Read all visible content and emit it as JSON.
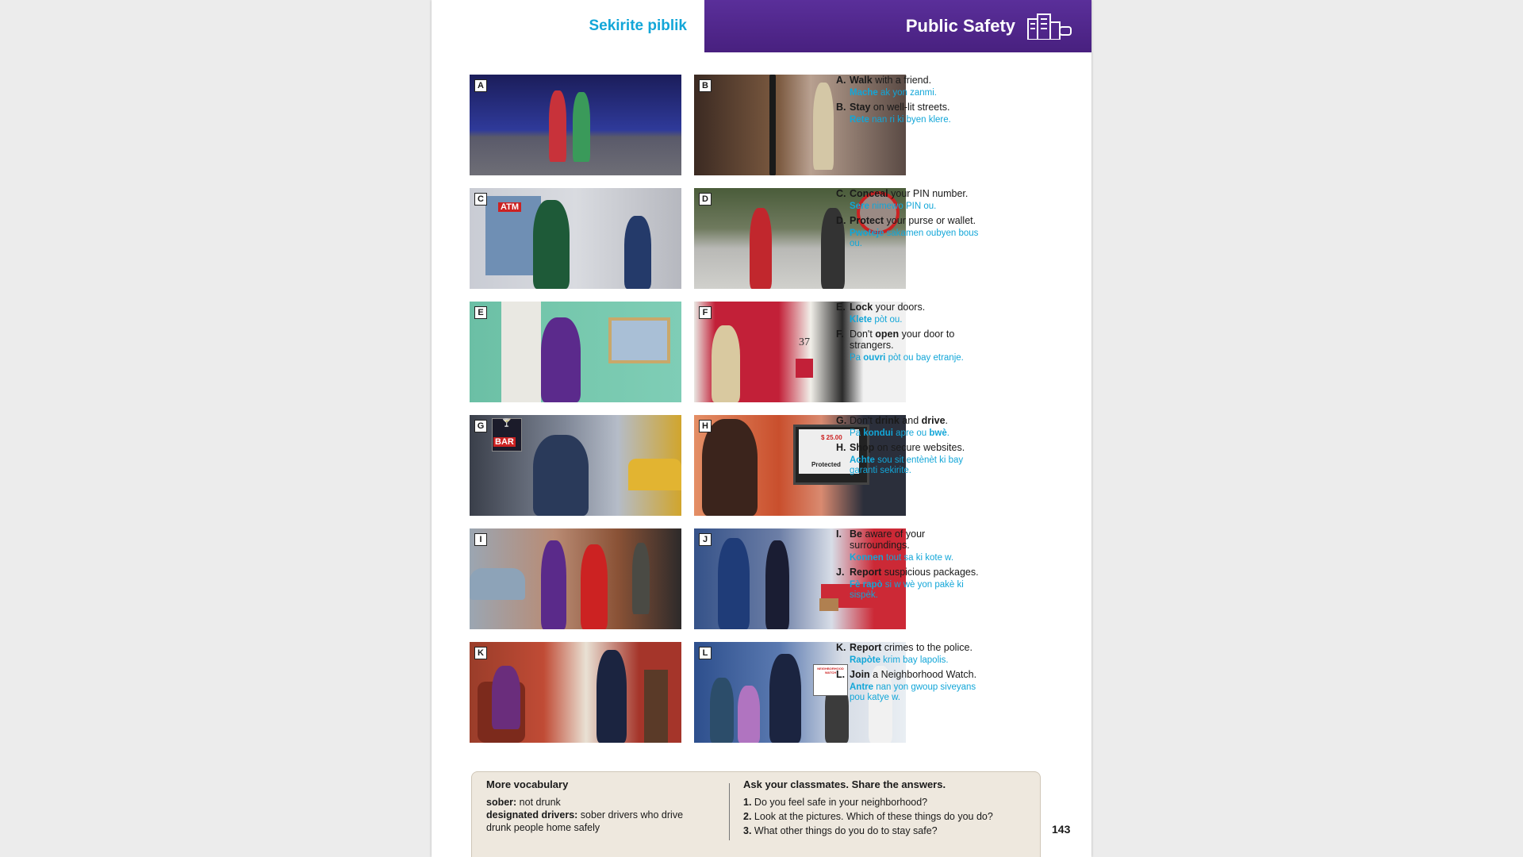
{
  "header": {
    "left_title": "Sekirite piblik",
    "right_title": "Public Safety",
    "header_color": "#4e2588",
    "accent_color": "#12a6d8"
  },
  "pictures": [
    {
      "letter": "A"
    },
    {
      "letter": "B"
    },
    {
      "letter": "C"
    },
    {
      "letter": "D"
    },
    {
      "letter": "E"
    },
    {
      "letter": "F"
    },
    {
      "letter": "G"
    },
    {
      "letter": "H"
    },
    {
      "letter": "I"
    },
    {
      "letter": "J"
    },
    {
      "letter": "K"
    },
    {
      "letter": "L"
    }
  ],
  "picture_text": {
    "atm": "ATM",
    "bar": "BAR",
    "house_number": "37",
    "price": "$ 25.00",
    "protected": "Protected",
    "watch_sign": "NEIGHBORHOOD WATCH"
  },
  "vocab": [
    {
      "letter": "A.",
      "bold": "Walk",
      "rest": " with a friend.",
      "ht_bold": "Mache",
      "ht_rest": " ak yon zanmi."
    },
    {
      "letter": "B.",
      "bold": "Stay",
      "rest": " on well-lit streets.",
      "ht_bold": "Rete",
      "ht_rest": " nan ri ki byen klere."
    },
    {
      "letter": "C.",
      "bold": "Conceal",
      "rest": " your PIN number.",
      "ht_bold": "Sere",
      "ht_rest": " nimewo PIN ou."
    },
    {
      "letter": "D.",
      "bold": "Protect",
      "rest": " your purse or wallet.",
      "ht_bold": "Pwoteje",
      "ht_rest": " sakamen oubyen bous ou."
    },
    {
      "letter": "E.",
      "bold": "Lock",
      "rest": " your doors.",
      "ht_bold": "Klete",
      "ht_rest": " pòt ou."
    },
    {
      "letter": "F.",
      "pre": "Don't ",
      "bold": "open",
      "rest": " your door to strangers.",
      "ht_pre": "Pa ",
      "ht_bold": "ouvri",
      "ht_rest": " pòt ou bay etranje."
    },
    {
      "letter": "G.",
      "pre": "Don't ",
      "bold": "drink",
      "mid": " and ",
      "bold2": "drive",
      "rest": ".",
      "ht_pre": "Pa ",
      "ht_bold": "kondui",
      "ht_mid": " apre ou ",
      "ht_bold2": "bwè",
      "ht_rest": "."
    },
    {
      "letter": "H.",
      "bold": "Shop",
      "rest": " on secure websites.",
      "ht_bold": "Achte",
      "ht_rest": " sou sit entènèt ki bay garanti sekirite."
    },
    {
      "letter": "I.",
      "bold": "Be",
      "rest": " aware of your surroundings.",
      "ht_bold": "Konnen",
      "ht_rest": " tout sa ki kote w."
    },
    {
      "letter": "J.",
      "bold": "Report",
      "rest": " suspicious packages.",
      "ht_bold": "Fè rapò",
      "ht_rest": " si w wè yon pakè ki sispèk."
    },
    {
      "letter": "K.",
      "bold": "Report",
      "rest": " crimes to the police.",
      "ht_bold": "Rapòte",
      "ht_rest": " krim bay lapolis."
    },
    {
      "letter": "L.",
      "bold": "Join",
      "rest": " a Neighborhood Watch.",
      "ht_bold": "Antre",
      "ht_rest": " nan yon gwoup siveyans pou katye w."
    }
  ],
  "more_vocab": {
    "title": "More vocabulary",
    "term1": "sober:",
    "def1": " not drunk",
    "term2": "designated drivers:",
    "def2": " sober drivers who drive drunk people home safely"
  },
  "ask": {
    "title": "Ask your classmates. Share the answers.",
    "questions": [
      {
        "num": "1.",
        "text": "Do you feel safe in your neighborhood?"
      },
      {
        "num": "2.",
        "text": "Look at the pictures. Which of these things do you do?"
      },
      {
        "num": "3.",
        "text": "What other things do you do to stay safe?"
      }
    ]
  },
  "page_number": "143"
}
